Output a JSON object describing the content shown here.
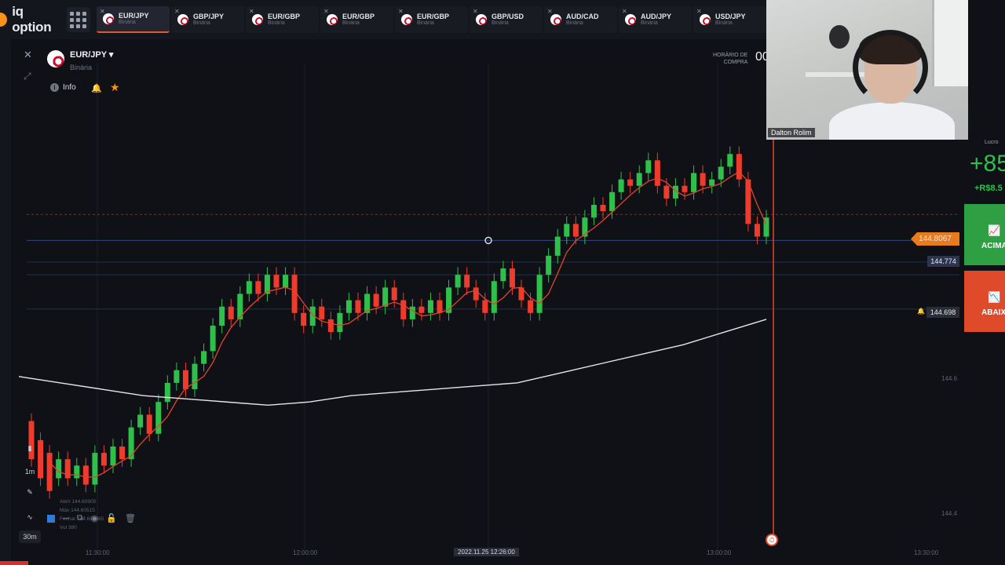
{
  "app": {
    "logo_text": "iq option"
  },
  "tabs": [
    {
      "name": "EUR/JPY",
      "sub": "Binária",
      "active": true
    },
    {
      "name": "GBP/JPY",
      "sub": "Binária"
    },
    {
      "name": "EUR/GBP",
      "sub": "Binária"
    },
    {
      "name": "EUR/GBP",
      "sub": "Binária"
    },
    {
      "name": "EUR/GBP",
      "sub": "Binária"
    },
    {
      "name": "GBP/USD",
      "sub": "Binária"
    },
    {
      "name": "AUD/CAD",
      "sub": "Binária"
    },
    {
      "name": "AUD/JPY",
      "sub": "Binária"
    },
    {
      "name": "USD/JPY",
      "sub": "Binária"
    }
  ],
  "asset": {
    "name": "EUR/JPY ▾",
    "sub": "Binária",
    "info_label": "Info"
  },
  "buy_time": {
    "label_line1": "HORÁRIO DE",
    "label_line2": "COMPRA",
    "value": "00"
  },
  "webcam": {
    "name": "Dalton Rolim"
  },
  "trade": {
    "profit_label": "Lucro",
    "profit_pct": "+85",
    "profit_amount": "+R$8.5",
    "up_label": "ACIMA",
    "down_label": "ABAIXO"
  },
  "price_tags": {
    "current": "144.8067",
    "line": "144.774",
    "alert": "144.698"
  },
  "price_axis": [
    "144.6",
    "144.4"
  ],
  "time_axis": [
    "11:30:00",
    "12:00:00",
    "13:00:00",
    "13:30:00"
  ],
  "time_current": "2022.11.25 12:26:00",
  "tools": {
    "candle_1m": "1m",
    "interval_30m": "30m"
  },
  "ohlc": {
    "open": "Abrir 144.60905",
    "max": "Máx 144.60515",
    "close": "Fechar 144.697465",
    "vol": "Vol 380"
  },
  "colors": {
    "up": "#2fbf4b",
    "down": "#ef3b2c",
    "accent": "#f7931a",
    "ma_fast": "#e0452c",
    "ma_slow": "#e6e6e6"
  },
  "chart_data": {
    "type": "candlestick",
    "y_range": [
      144.35,
      144.93
    ],
    "candles": [
      [
        144.49,
        144.43
      ],
      [
        144.46,
        144.4
      ],
      [
        144.44,
        144.38
      ],
      [
        144.4,
        144.43
      ],
      [
        144.43,
        144.4
      ],
      [
        144.4,
        144.42
      ],
      [
        144.42,
        144.39
      ],
      [
        144.39,
        144.44
      ],
      [
        144.44,
        144.42
      ],
      [
        144.42,
        144.45
      ],
      [
        144.45,
        144.43
      ],
      [
        144.43,
        144.48
      ],
      [
        144.48,
        144.5
      ],
      [
        144.5,
        144.47
      ],
      [
        144.47,
        144.52
      ],
      [
        144.52,
        144.55
      ],
      [
        144.55,
        144.57
      ],
      [
        144.57,
        144.54
      ],
      [
        144.54,
        144.58
      ],
      [
        144.58,
        144.6
      ],
      [
        144.6,
        144.64
      ],
      [
        144.64,
        144.67
      ],
      [
        144.67,
        144.65
      ],
      [
        144.65,
        144.69
      ],
      [
        144.69,
        144.71
      ],
      [
        144.71,
        144.69
      ],
      [
        144.69,
        144.72
      ],
      [
        144.72,
        144.7
      ],
      [
        144.7,
        144.72
      ],
      [
        144.72,
        144.66
      ],
      [
        144.66,
        144.64
      ],
      [
        144.64,
        144.67
      ],
      [
        144.67,
        144.65
      ],
      [
        144.65,
        144.63
      ],
      [
        144.63,
        144.66
      ],
      [
        144.66,
        144.68
      ],
      [
        144.68,
        144.66
      ],
      [
        144.66,
        144.69
      ],
      [
        144.69,
        144.67
      ],
      [
        144.67,
        144.7
      ],
      [
        144.7,
        144.68
      ],
      [
        144.68,
        144.65
      ],
      [
        144.65,
        144.67
      ],
      [
        144.67,
        144.66
      ],
      [
        144.66,
        144.68
      ],
      [
        144.68,
        144.66
      ],
      [
        144.66,
        144.7
      ],
      [
        144.7,
        144.72
      ],
      [
        144.72,
        144.7
      ],
      [
        144.7,
        144.68
      ],
      [
        144.68,
        144.66
      ],
      [
        144.66,
        144.71
      ],
      [
        144.71,
        144.73
      ],
      [
        144.73,
        144.7
      ],
      [
        144.7,
        144.68
      ],
      [
        144.68,
        144.66
      ],
      [
        144.66,
        144.72
      ],
      [
        144.72,
        144.75
      ],
      [
        144.75,
        144.78
      ],
      [
        144.78,
        144.8
      ],
      [
        144.8,
        144.78
      ],
      [
        144.78,
        144.81
      ],
      [
        144.81,
        144.83
      ],
      [
        144.83,
        144.82
      ],
      [
        144.82,
        144.85
      ],
      [
        144.85,
        144.87
      ],
      [
        144.87,
        144.86
      ],
      [
        144.86,
        144.88
      ],
      [
        144.88,
        144.9
      ],
      [
        144.9,
        144.86
      ],
      [
        144.86,
        144.84
      ],
      [
        144.84,
        144.86
      ],
      [
        144.86,
        144.85
      ],
      [
        144.85,
        144.88
      ],
      [
        144.88,
        144.86
      ],
      [
        144.86,
        144.87
      ],
      [
        144.87,
        144.89
      ],
      [
        144.89,
        144.91
      ],
      [
        144.91,
        144.87
      ],
      [
        144.87,
        144.8
      ],
      [
        144.8,
        144.78
      ],
      [
        144.78,
        144.81
      ]
    ],
    "ma_slow": [
      144.62,
      144.61,
      144.6,
      144.59,
      144.585,
      144.58,
      144.575,
      144.58,
      144.59,
      144.595,
      144.6,
      144.605,
      144.61,
      144.625,
      144.64,
      144.655,
      144.67,
      144.69,
      144.71
    ],
    "h_lines": [
      144.774,
      144.74,
      144.72,
      144.666
    ]
  }
}
